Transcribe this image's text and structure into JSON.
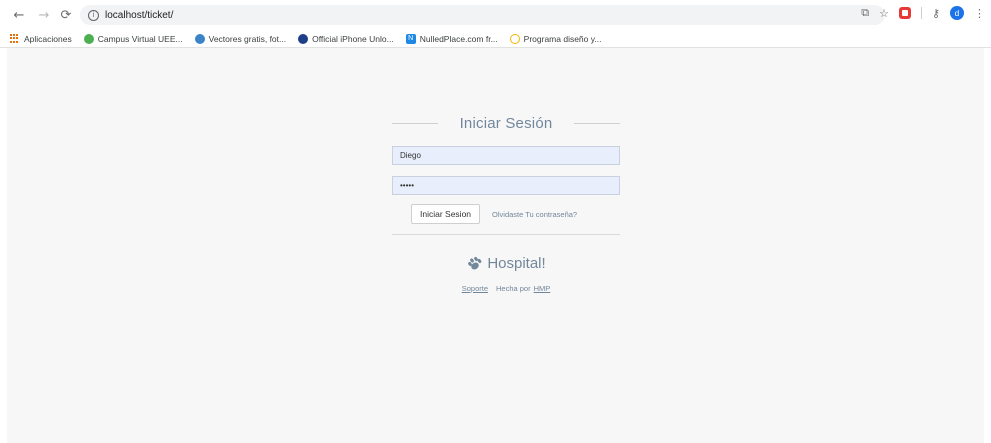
{
  "browser": {
    "url": "localhost/ticket/",
    "avatar_letter": "d"
  },
  "bookmarks": [
    {
      "label": "Aplicaciones",
      "icon": "apps-grid-icon"
    },
    {
      "label": "Campus Virtual UEE...",
      "icon": "campus-icon"
    },
    {
      "label": "Vectores gratis, fot...",
      "icon": "freepik-icon"
    },
    {
      "label": "Official iPhone Unlo...",
      "icon": "unlock-icon"
    },
    {
      "label": "NulledPlace.com fr...",
      "icon": "n-logo-icon"
    },
    {
      "label": "Programa diseño y...",
      "icon": "design-icon"
    }
  ],
  "login": {
    "title": "Iniciar Sesión",
    "username_value": "Diego",
    "password_value": "•••••",
    "submit_label": "Iniciar Sesion",
    "forgot_label": "Olvidaste Tu contraseña?"
  },
  "brand": {
    "name": "Hospital!",
    "icon": "paw-icon"
  },
  "footer": {
    "support_label": "Soporte",
    "made_by_label": "Hecha por",
    "made_by_link": "HMP"
  },
  "colors": {
    "accent": "#73879c",
    "input_bg": "#e8eefb",
    "page_bg": "#f7f7f7"
  }
}
